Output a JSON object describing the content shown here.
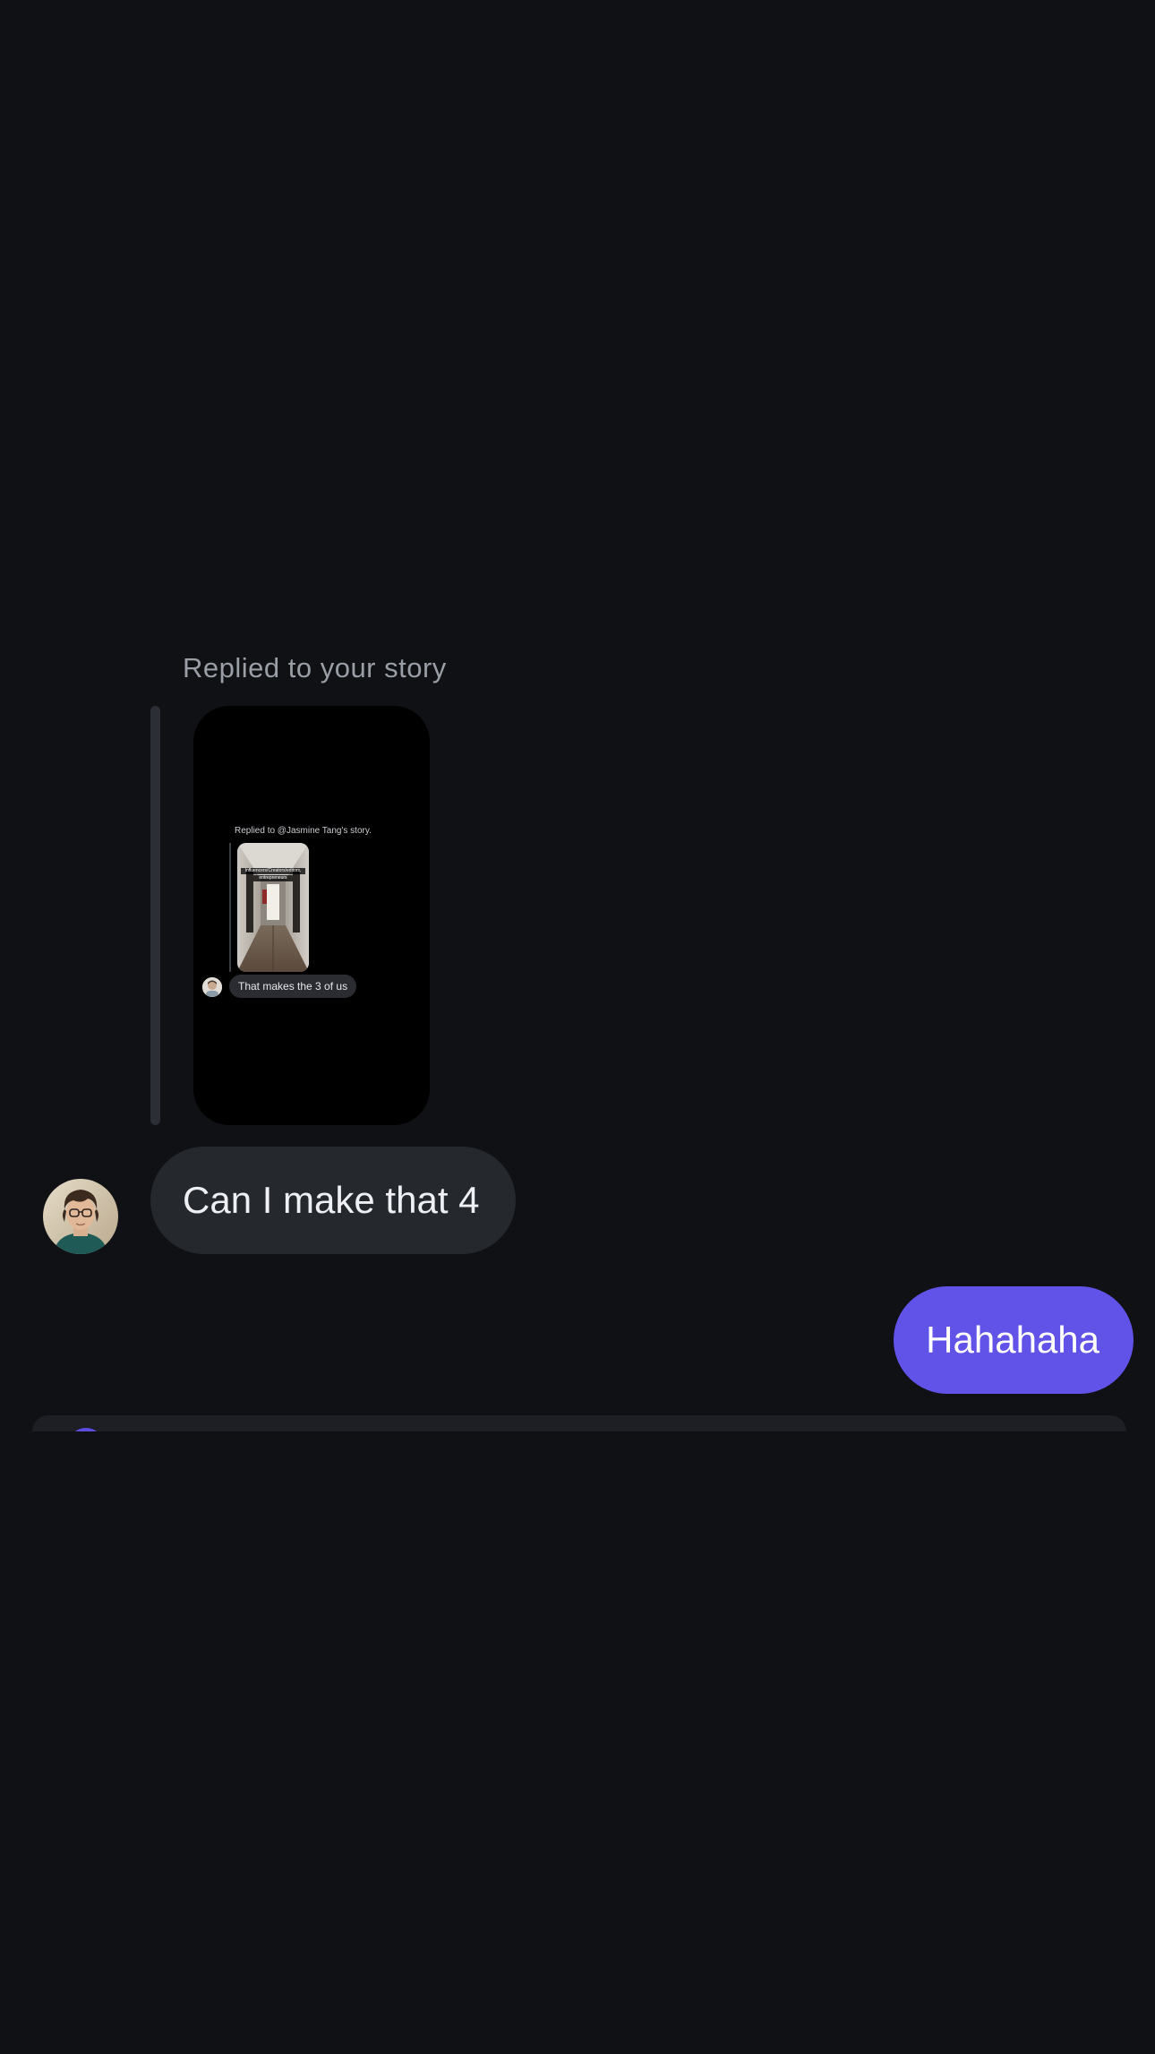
{
  "thread": {
    "reply_caption": "Replied to your story",
    "story_preview": {
      "inner_caption": "Replied to @Jasmine Tang's story.",
      "thumb_label_line1": "Influencers/Creators/editors,",
      "thumb_label_line2": "entrepreneurs",
      "inner_reply": "That makes the 3 of us"
    },
    "messages": [
      {
        "direction": "incoming",
        "text": "Can I make that 4"
      },
      {
        "direction": "outgoing",
        "text": "Hahahaha"
      }
    ]
  },
  "colors": {
    "background": "#0f1115",
    "incoming_bubble": "#25282d",
    "outgoing_bubble": "#6152e8",
    "caption_text": "#9a9ea6"
  },
  "icons": {
    "composer_button": "camera-icon"
  }
}
